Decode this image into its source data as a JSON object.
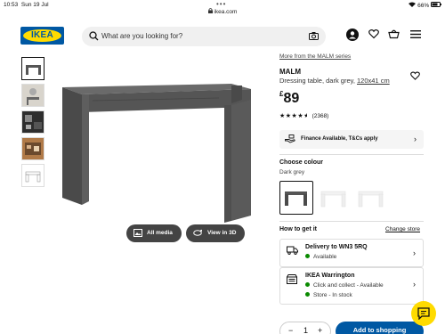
{
  "status_bar": {
    "time": "10:53",
    "date": "Sun 19 Jul",
    "url": "ikea.com",
    "battery": "66%"
  },
  "header": {
    "logo_text": "IKEA",
    "search_placeholder": "What are you looking for?",
    "icons": [
      "search-icon",
      "camera-icon",
      "account-icon",
      "heart-icon",
      "basket-icon",
      "menu-icon"
    ]
  },
  "gallery": {
    "buttons": {
      "all_media": "All media",
      "view_3d": "View in 3D"
    }
  },
  "product": {
    "series_link": "More from the MALM series",
    "name": "MALM",
    "description": "Dressing table, dark grey,",
    "dimensions": "120x41 cm",
    "currency": "£",
    "price": "89",
    "rating_stars": 4.5,
    "rating_count": "(2368)",
    "finance_text": "Finance Available, T&Cs apply"
  },
  "colour": {
    "title": "Choose colour",
    "selected": "Dark grey",
    "swatch_colors": [
      "#5a5a5a",
      "#f4f4f4",
      "#f4f4f4"
    ]
  },
  "get_it": {
    "title": "How to get it",
    "change_link": "Change store",
    "delivery": {
      "title": "Delivery to WN3 5RQ",
      "status": "Available"
    },
    "store": {
      "title": "IKEA Warrington",
      "line1": "Click and collect - Available",
      "line2": "Store - In stock"
    }
  },
  "cart": {
    "minus": "−",
    "quantity": "1",
    "plus": "+",
    "add_label": "Add to shopping"
  },
  "colors": {
    "ikea_blue": "#0058a3",
    "ikea_yellow": "#ffdb00",
    "available_green": "#0a8a00"
  }
}
